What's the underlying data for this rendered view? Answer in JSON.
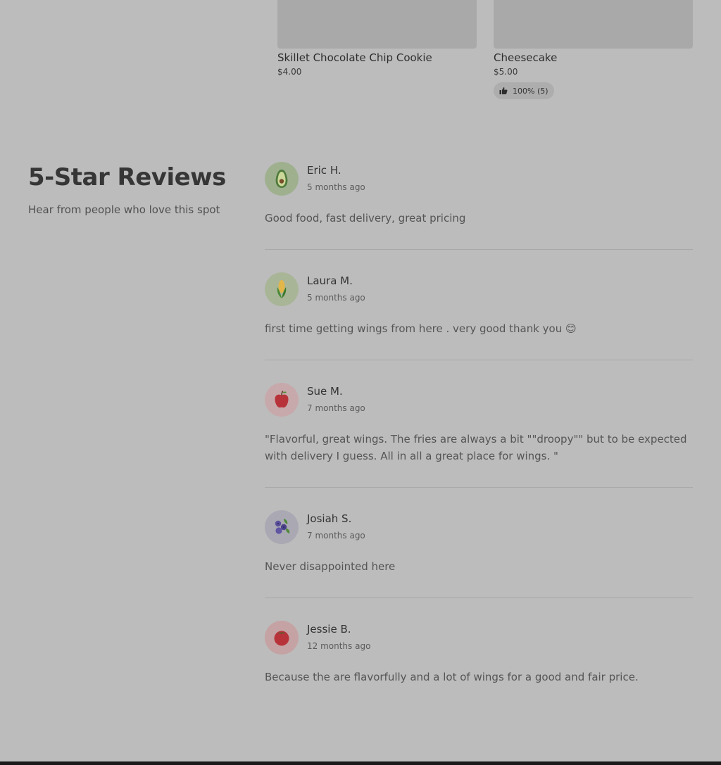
{
  "products": [
    {
      "name": "Skillet Chocolate Chip Cookie",
      "price": "$4.00",
      "rating": null
    },
    {
      "name": "Cheesecake",
      "price": "$5.00",
      "rating": "100% (5)"
    }
  ],
  "reviews_section": {
    "title": "5-Star Reviews",
    "subtitle": "Hear from people who love this spot"
  },
  "reviews": [
    {
      "name": "Eric H.",
      "date": "5 months ago",
      "text": "Good food, fast delivery, great pricing",
      "avatar_icon": "avocado-icon",
      "avatar_bg": "#9fb08f"
    },
    {
      "name": "Laura M.",
      "date": "5 months ago",
      "text": "first time getting wings from here . very good thank you 😊",
      "avatar_icon": "corn-icon",
      "avatar_bg": "#a9b597"
    },
    {
      "name": "Sue M.",
      "date": "7 months ago",
      "text": "\"Flavorful, great wings. The fries are always a bit \"\"droopy\"\" but to be expected with delivery I guess. All in all a great place for wings. \"",
      "avatar_icon": "apple-icon",
      "avatar_bg": "#c7a9ab"
    },
    {
      "name": "Josiah S.",
      "date": "7 months ago",
      "text": "Never disappointed here",
      "avatar_icon": "blueberries-icon",
      "avatar_bg": "#a9a8b3"
    },
    {
      "name": "Jessie B.",
      "date": "12 months ago",
      "text": "Because the are flavorfully and a lot of wings for a good and fair price.",
      "avatar_icon": "tomato-icon",
      "avatar_bg": "#c5a2a3"
    }
  ]
}
